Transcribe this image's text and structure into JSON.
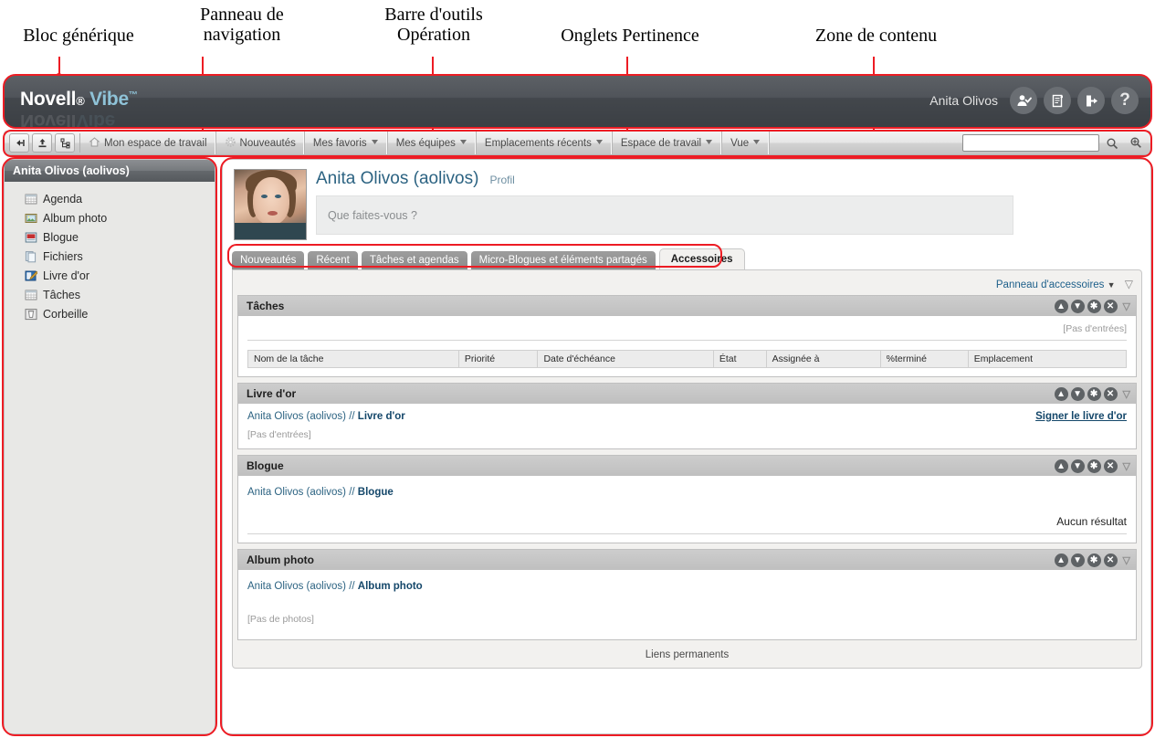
{
  "callouts": [
    {
      "text": "Bloc générique",
      "id": "bloc-generique"
    },
    {
      "text": "Panneau de\nnavigation",
      "id": "panneau-navigation"
    },
    {
      "text": "Barre d'outils\nOpération",
      "id": "barre-outils-operation"
    },
    {
      "text": "Onglets Pertinence",
      "id": "onglets-pertinence"
    },
    {
      "text": "Zone de contenu",
      "id": "zone-contenu"
    }
  ],
  "header": {
    "logo_novell": "Novell",
    "logo_reg": "®",
    "logo_vibe": "Vibe",
    "logo_tm": "™",
    "user_name": "Anita Olivos",
    "icons": [
      "user-check-icon",
      "clipboard-arrow-icon",
      "logout-icon",
      "help-icon"
    ],
    "help_glyph": "?",
    "brand_accent": "#8fc3d8",
    "bar_color": "#4b4f54"
  },
  "navbar": {
    "tools": [
      "back-arrow-icon",
      "upload-icon",
      "tree-view-icon"
    ],
    "items": [
      {
        "label": "Mon espace de travail",
        "icon": "home-icon",
        "arrow": false
      },
      {
        "label": "Nouveautés",
        "icon": "gear-icon",
        "arrow": false
      },
      {
        "label": "Mes favoris",
        "icon": "",
        "arrow": true
      },
      {
        "label": "Mes équipes",
        "icon": "",
        "arrow": true
      },
      {
        "label": "Emplacements récents",
        "icon": "",
        "arrow": true
      },
      {
        "label": "Espace de travail",
        "icon": "",
        "arrow": true
      },
      {
        "label": "Vue",
        "icon": "",
        "arrow": true
      }
    ],
    "search_value": "",
    "search_placeholder": "",
    "search_icon": "magnifier-icon",
    "advanced_search_icon": "magnifier-plus-icon"
  },
  "sidebar": {
    "title": "Anita Olivos (aolivos)",
    "items": [
      {
        "label": "Agenda",
        "icon": "calendar-icon"
      },
      {
        "label": "Album photo",
        "icon": "photo-icon"
      },
      {
        "label": "Blogue",
        "icon": "blog-icon"
      },
      {
        "label": "Fichiers",
        "icon": "files-icon"
      },
      {
        "label": "Livre d'or",
        "icon": "guestbook-icon"
      },
      {
        "label": "Tâches",
        "icon": "tasks-icon"
      },
      {
        "label": "Corbeille",
        "icon": "trash-icon"
      }
    ]
  },
  "profile": {
    "name": "Anita Olivos (aolivos)",
    "profile_link": "Profil",
    "status_placeholder": "Que faites-vous ?",
    "avatar_alt": "avatar"
  },
  "tabs": [
    {
      "label": "Nouveautés",
      "active": false
    },
    {
      "label": "Récent",
      "active": false
    },
    {
      "label": "Tâches et agendas",
      "active": false
    },
    {
      "label": "Micro-Blogues et éléments partagés",
      "active": false
    },
    {
      "label": "Accessoires",
      "active": true
    }
  ],
  "accessories": {
    "panel_link": "Panneau d'accessoires",
    "panels": [
      {
        "title": "Tâches",
        "empty_text": "[Pas d'entrées]",
        "columns": [
          "Nom de la tâche",
          "Priorité",
          "Date d'échéance",
          "État",
          "Assignée à",
          "%terminé",
          "Emplacement"
        ],
        "rows": []
      },
      {
        "title": "Livre d'or",
        "crumb_prefix": "Anita Olivos (aolivos) // ",
        "crumb_bold": "Livre d'or",
        "action_link": "Signer le livre d'or",
        "empty_text": "[Pas d'entrées]"
      },
      {
        "title": "Blogue",
        "crumb_prefix": "Anita Olivos (aolivos) // ",
        "crumb_bold": "Blogue",
        "empty_text": "Aucun résultat"
      },
      {
        "title": "Album photo",
        "crumb_prefix": "Anita Olivos (aolivos) // ",
        "crumb_bold": "Album photo",
        "empty_text": "[Pas de photos]"
      }
    ],
    "permalinks": "Liens permanents",
    "icons": [
      "move-up-icon",
      "move-down-icon",
      "configure-icon",
      "close-icon",
      "collapse-caret-icon"
    ]
  },
  "annotation_color": "#ED1C24"
}
